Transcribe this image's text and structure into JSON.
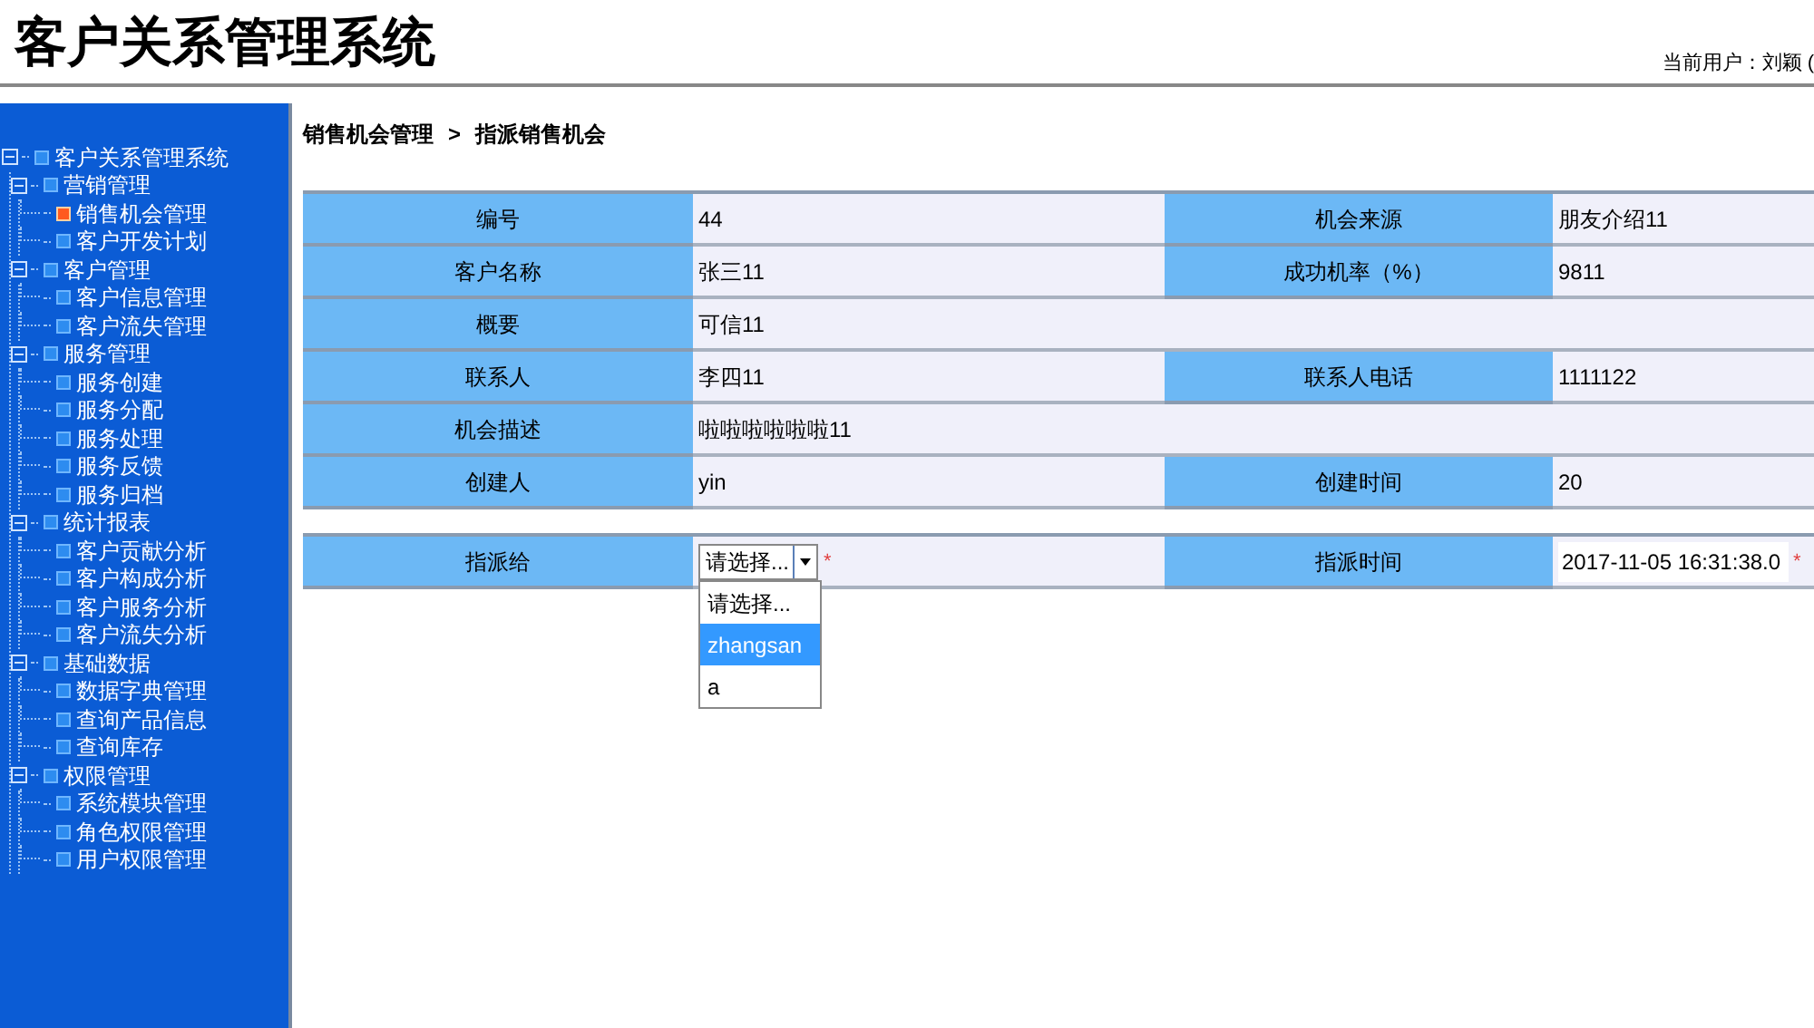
{
  "header": {
    "title": "客户关系管理系统",
    "current_user": "当前用户：刘颖 ("
  },
  "sidebar": {
    "tree": [
      {
        "label": "客户关系管理系统",
        "expanded": true,
        "children": [
          {
            "label": "营销管理",
            "expanded": true,
            "children": [
              {
                "label": "销售机会管理",
                "selected": true
              },
              {
                "label": "客户开发计划",
                "selected": false
              }
            ]
          },
          {
            "label": "客户管理",
            "expanded": true,
            "children": [
              {
                "label": "客户信息管理",
                "selected": false
              },
              {
                "label": "客户流失管理",
                "selected": false
              }
            ]
          },
          {
            "label": "服务管理",
            "expanded": true,
            "children": [
              {
                "label": "服务创建",
                "selected": false
              },
              {
                "label": "服务分配",
                "selected": false
              },
              {
                "label": "服务处理",
                "selected": false
              },
              {
                "label": "服务反馈",
                "selected": false
              },
              {
                "label": "服务归档",
                "selected": false
              }
            ]
          },
          {
            "label": "统计报表",
            "expanded": true,
            "children": [
              {
                "label": "客户贡献分析",
                "selected": false
              },
              {
                "label": "客户构成分析",
                "selected": false
              },
              {
                "label": "客户服务分析",
                "selected": false
              },
              {
                "label": "客户流失分析",
                "selected": false
              }
            ]
          },
          {
            "label": "基础数据",
            "expanded": true,
            "children": [
              {
                "label": "数据字典管理",
                "selected": false
              },
              {
                "label": "查询产品信息",
                "selected": false
              },
              {
                "label": "查询库存",
                "selected": false
              }
            ]
          },
          {
            "label": "权限管理",
            "expanded": true,
            "children": [
              {
                "label": "系统模块管理",
                "selected": false
              },
              {
                "label": "角色权限管理",
                "selected": false
              },
              {
                "label": "用户权限管理",
                "selected": false
              }
            ]
          }
        ]
      }
    ]
  },
  "breadcrumb": [
    "销售机会管理",
    ">",
    "指派销售机会"
  ],
  "details": [
    {
      "fields": [
        {
          "label": "编号",
          "value": "44"
        },
        {
          "label": "机会来源",
          "value": "朋友介绍11"
        }
      ]
    },
    {
      "fields": [
        {
          "label": "客户名称",
          "value": "张三11"
        },
        {
          "label": "成功机率（%）",
          "value": "9811"
        }
      ]
    },
    {
      "fields": [
        {
          "label": "概要",
          "value": "可信11"
        }
      ]
    },
    {
      "fields": [
        {
          "label": "联系人",
          "value": "李四11"
        },
        {
          "label": "联系人电话",
          "value": "1111122"
        }
      ]
    },
    {
      "fields": [
        {
          "label": "机会描述",
          "value": "啦啦啦啦啦啦11"
        }
      ]
    },
    {
      "fields": [
        {
          "label": "创建人",
          "value": "yin"
        },
        {
          "label": "创建时间",
          "value": "20"
        }
      ]
    }
  ],
  "assign": {
    "label": "指派给",
    "select": {
      "value": "请选择...",
      "open": true,
      "options": [
        {
          "label": "请选择...",
          "highlighted": false
        },
        {
          "label": "zhangsan",
          "highlighted": true
        },
        {
          "label": "a",
          "highlighted": false
        }
      ]
    },
    "required": "*",
    "time_label": "指派时间",
    "time_value": "2017-11-05 16:31:38.0",
    "time_required": "*"
  }
}
